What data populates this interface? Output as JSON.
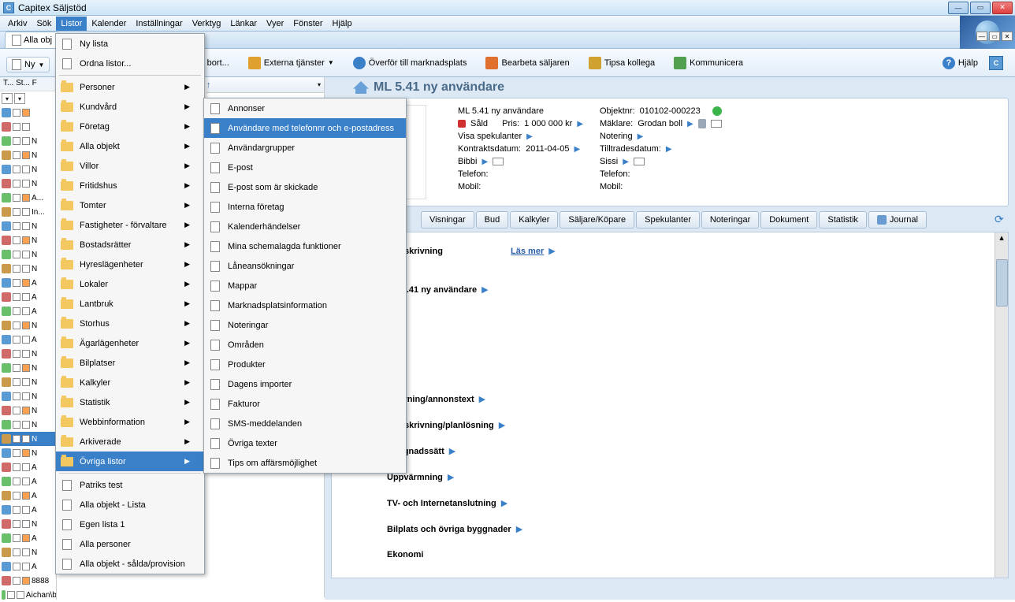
{
  "title": "Capitex Säljstöd",
  "menubar": [
    "Arkiv",
    "Sök",
    "Listor",
    "Kalender",
    "Inställningar",
    "Verktyg",
    "Länkar",
    "Vyer",
    "Fönster",
    "Hjälp"
  ],
  "active_menu_index": 2,
  "tab_label": "Alla obj",
  "ny_btn": "Ny",
  "toolbar": {
    "tabort": "Ta bort...",
    "externa": "Externa tjänster",
    "overfor": "Överför till marknadsplats",
    "bearbeta": "Bearbeta säljaren",
    "tipsa": "Tipsa kollega",
    "kom": "Kommunicera",
    "help": "Hjälp"
  },
  "left_header": "T... St... F",
  "left_rows": [
    {
      "t": ""
    },
    {
      "t": ""
    },
    {
      "t": "N"
    },
    {
      "t": "N"
    },
    {
      "t": "N"
    },
    {
      "t": "N"
    },
    {
      "t": "A..."
    },
    {
      "t": "In..."
    },
    {
      "t": "N"
    },
    {
      "t": "N"
    },
    {
      "t": "N"
    },
    {
      "t": "N"
    },
    {
      "t": "A"
    },
    {
      "t": "A"
    },
    {
      "t": "A"
    },
    {
      "t": "N"
    },
    {
      "t": "A"
    },
    {
      "t": "N"
    },
    {
      "t": "N"
    },
    {
      "t": "N"
    },
    {
      "t": "N"
    },
    {
      "t": "N"
    },
    {
      "t": "N"
    },
    {
      "t": "N",
      "sel": true
    },
    {
      "t": "N"
    },
    {
      "t": "A"
    },
    {
      "t": "A"
    },
    {
      "t": "A"
    },
    {
      "t": "A"
    },
    {
      "t": "N"
    },
    {
      "t": "A"
    },
    {
      "t": "N"
    },
    {
      "t": "A"
    },
    {
      "t": "8888"
    },
    {
      "t": "Aichan\\bute av objek"
    }
  ],
  "dropdown1": {
    "top": [
      "Ny lista",
      "Ordna listor..."
    ],
    "cats": [
      "Personer",
      "Kundvård",
      "Företag",
      "Alla objekt",
      "Villor",
      "Fritidshus",
      "Tomter",
      "Fastigheter - förvaltare",
      "Bostadsrätter",
      "Hyreslägenheter",
      "Lokaler",
      "Lantbruk",
      "Storhus",
      "Ägarlägenheter",
      "Bilplatser",
      "Kalkyler",
      "Statistik",
      "Webbinformation",
      "Arkiverade",
      "Övriga listor"
    ],
    "sel_index": 19,
    "bottom": [
      "Patriks test",
      "Alla objekt - Lista",
      "Egen lista 1",
      "Alla personer",
      "Alla objekt - sålda/provision"
    ]
  },
  "dropdown2": {
    "items": [
      "Annonser",
      "Användare med telefonnr och e-postadress",
      "Användargrupper",
      "E-post",
      "E-post som är skickade",
      "Interna företag",
      "Kalenderhändelser",
      "Mina schemalagda funktioner",
      "Låneansökningar",
      "Mappar",
      "Marknadsplatsinformation",
      "Noteringar",
      "Områden",
      "Produkter",
      "Dagens importer",
      "Fakturor",
      "SMS-meddelanden",
      "Övriga texter",
      "Tips om affärsmöjlighet"
    ],
    "sel_index": 1
  },
  "detail": {
    "title": "ML 5.41 ny användare",
    "name": "ML 5.41 ny användare",
    "objektnr_label": "Objektnr:",
    "objektnr": "010102-000223",
    "sald": "Såld",
    "pris_label": "Pris:",
    "pris": "1 000 000 kr",
    "maklare_label": "Mäklare:",
    "maklare": "Grodan boll",
    "visa_spek": "Visa spekulanter",
    "notering": "Notering",
    "kontrakt_label": "Kontraktsdatum:",
    "kontrakt": "2011-04-05",
    "tilltrade": "Tilltradesdatum:",
    "bibbi": "Bibbi",
    "sissi": "Sissi",
    "telefon": "Telefon:",
    "mobil": "Mobil:"
  },
  "dtabs": [
    "Visningar",
    "Bud",
    "Kalkyler",
    "Säljare/Köpare",
    "Spekulanter",
    "Noteringar",
    "Dokument",
    "Statistik",
    "Journal"
  ],
  "content": {
    "l1a": "il beskrivning",
    "l1b": "Läs mer",
    "l2": "ML 5.41 ny användare",
    "l3": "skrivning/annonstext",
    "l4": "...beskrivning/planlösning",
    "l5": "Byggnadssätt",
    "l6": "Uppvärmning",
    "l7": "TV- och Internetanslutning",
    "l8": "Bilplats och övriga byggnader",
    "l9": "Ekonomi"
  }
}
